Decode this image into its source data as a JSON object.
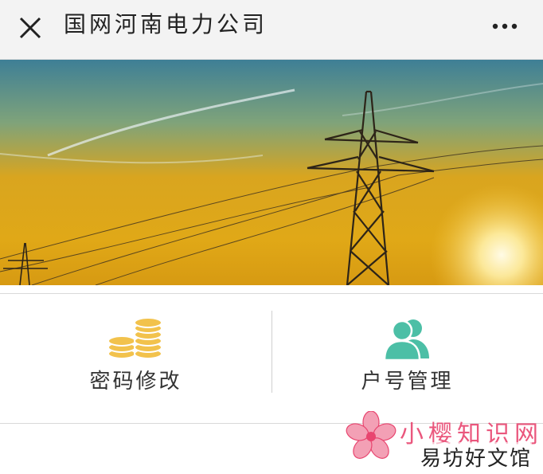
{
  "header": {
    "title": "国网河南电力公司",
    "close_icon": "close-icon",
    "more_icon": "more-dots-icon"
  },
  "banner": {
    "description_icon": "power-tower-sunset-image"
  },
  "menu": {
    "items": [
      {
        "label": "密码修改",
        "icon": "coins-icon",
        "color": "#f2c24c"
      },
      {
        "label": "户号管理",
        "icon": "users-icon",
        "color": "#4cbfa6"
      }
    ]
  },
  "watermark": {
    "title": "小樱知识网",
    "subtitle": "易坊好文馆",
    "logo_icon": "sakura-flower-icon",
    "color": "#e8456f"
  }
}
